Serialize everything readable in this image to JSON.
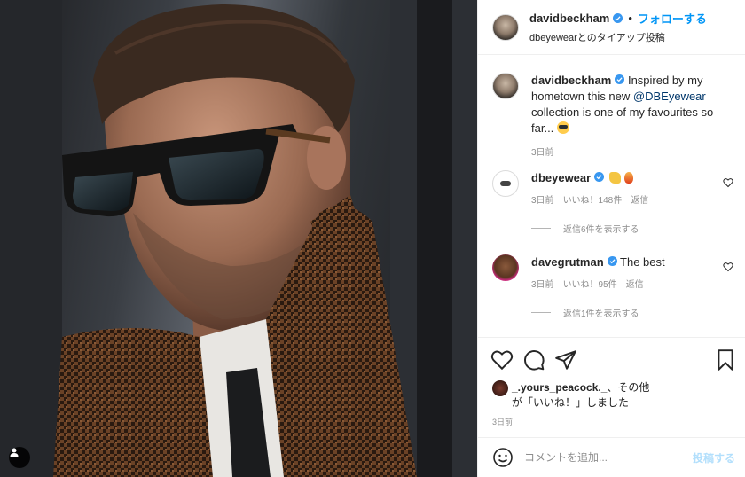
{
  "header": {
    "username": "davidbeckham",
    "separator": "•",
    "follow_label": "フォローする",
    "subtitle": "dbeyewearとのタイアップ投稿"
  },
  "caption": {
    "username": "davidbeckham",
    "text_before": "Inspired by my hometown this new ",
    "mention": "@DBEyewear",
    "text_after": " collection is one of my favourites so far... ",
    "time": "3日前"
  },
  "comments": [
    {
      "username": "dbeyewear",
      "text": "",
      "time": "3日前",
      "likes": "いいね！148件",
      "reply_label": "返信",
      "view_replies": "返信6件を表示する"
    },
    {
      "username": "davegrutman",
      "text": "The best",
      "time": "3日前",
      "likes": "いいね！95件",
      "reply_label": "返信",
      "view_replies": "返信1件を表示する"
    }
  ],
  "likes_summary": {
    "username": "_.yours_peacock._",
    "text_mid": "、その他",
    "text_end": "が「いいね！」しました",
    "time": "3日前"
  },
  "comment_input": {
    "placeholder": "コメントを追加...",
    "post_label": "投稿する"
  },
  "icons": {
    "verified": "verified-badge-icon",
    "heart": "heart-icon",
    "comment": "comment-icon",
    "share": "share-icon",
    "bookmark": "bookmark-icon",
    "emoji": "smiley-icon",
    "user_tag": "user-tag-icon"
  },
  "colors": {
    "accent": "#0095f6",
    "verified": "#3897f0",
    "muted": "#8e8e8e",
    "post_disabled": "#b2dffc"
  }
}
